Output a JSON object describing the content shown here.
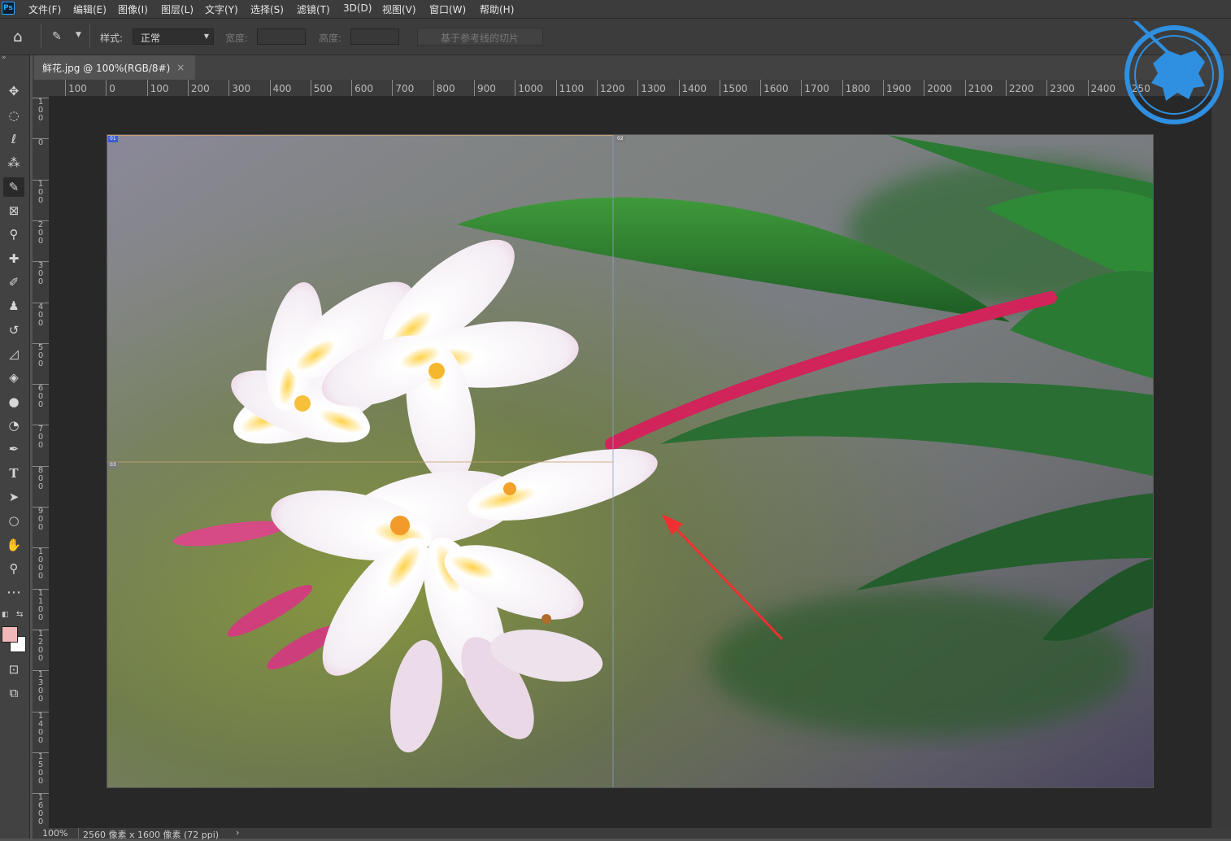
{
  "app": {
    "logo": "Ps"
  },
  "menu": [
    "文件(F)",
    "编辑(E)",
    "图像(I)",
    "图层(L)",
    "文字(Y)",
    "选择(S)",
    "滤镜(T)",
    "3D(D)",
    "视图(V)",
    "窗口(W)",
    "帮助(H)"
  ],
  "options": {
    "style_label": "样式:",
    "style_value": "正常",
    "width_label": "宽度:",
    "height_label": "高度:",
    "guides_slice_button": "基于参考线的切片"
  },
  "document": {
    "tab_title": "鲜花.jpg @ 100%(RGB/8#)",
    "tab_close": "×"
  },
  "ruler_h": [
    "100",
    "0",
    "100",
    "200",
    "300",
    "400",
    "500",
    "600",
    "700",
    "800",
    "900",
    "1000",
    "1100",
    "1200",
    "1300",
    "1400",
    "1500",
    "1600",
    "1700",
    "1800",
    "1900",
    "2000",
    "2100",
    "2200",
    "2300",
    "2400",
    "250"
  ],
  "ruler_v": [
    "1\n0\n0",
    "0",
    "1\n0\n0",
    "2\n0\n0",
    "3\n0\n0",
    "4\n0\n0",
    "5\n0\n0",
    "6\n0\n0",
    "7\n0\n0",
    "8\n0\n0",
    "9\n0\n0",
    "1\n0\n0\n0",
    "1\n1\n0\n0",
    "1\n2\n0\n0",
    "1\n3\n0\n0",
    "1\n4\n0\n0",
    "1\n5\n0\n0",
    "1\n6\n0\n0"
  ],
  "slices": [
    "01",
    "02",
    "03"
  ],
  "status": {
    "zoom": "100%",
    "doc_info": "2560 像素 x 1600 像素 (72 ppi)",
    "arrow": "›"
  },
  "colors": {
    "accent": "#31a8ff",
    "foreground_swatch": "#f0b8b8",
    "background_swatch": "#ffffff",
    "annotation_arrow": "#f03030"
  }
}
